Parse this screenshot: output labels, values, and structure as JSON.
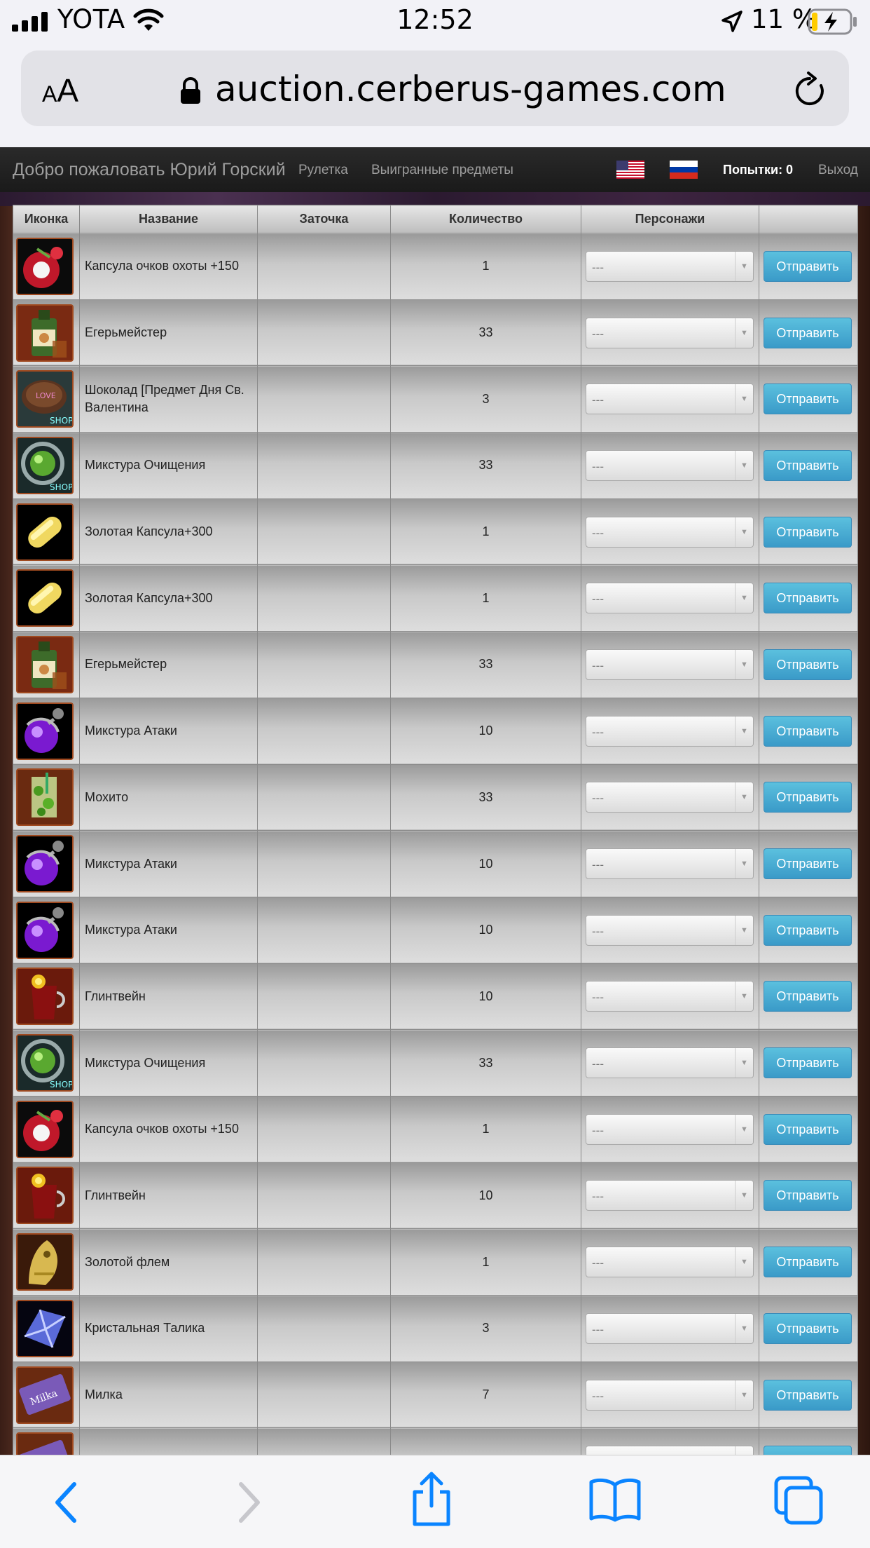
{
  "status_bar": {
    "carrier": "YOTA",
    "time": "12:52",
    "battery": "11 %"
  },
  "browser": {
    "text_size_label": "AA",
    "url": "auction.cerberus-games.com"
  },
  "nav": {
    "welcome": "Добро пожаловать Юрий Горский",
    "roulette": "Рулетка",
    "won_items": "Выигранные предметы",
    "attempts": "Попытки: 0",
    "logout": "Выход"
  },
  "table": {
    "headers": [
      "Иконка",
      "Название",
      "Заточка",
      "Количество",
      "Персонажи",
      ""
    ],
    "select_default": "---",
    "send_label": "Отправить",
    "rows": [
      {
        "name": "Капсула очков охоты +150",
        "enchant": "",
        "qty": "1",
        "icon": "hunt-capsule-icon"
      },
      {
        "name": "Егерьмейстер",
        "enchant": "",
        "qty": "33",
        "icon": "liquor-bottle-icon"
      },
      {
        "name": "Шоколад [Предмет Дня Св. Валентина",
        "enchant": "",
        "qty": "3",
        "icon": "chocolate-icon"
      },
      {
        "name": "Микстура Очищения",
        "enchant": "",
        "qty": "33",
        "icon": "cleansing-potion-icon"
      },
      {
        "name": "Золотая Капсула+300",
        "enchant": "",
        "qty": "1",
        "icon": "gold-capsule-icon"
      },
      {
        "name": "Золотая Капсула+300",
        "enchant": "",
        "qty": "1",
        "icon": "gold-capsule-icon"
      },
      {
        "name": "Егерьмейстер",
        "enchant": "",
        "qty": "33",
        "icon": "liquor-bottle-icon"
      },
      {
        "name": "Микстура Атаки",
        "enchant": "",
        "qty": "10",
        "icon": "attack-potion-icon"
      },
      {
        "name": "Мохито",
        "enchant": "",
        "qty": "33",
        "icon": "mojito-icon"
      },
      {
        "name": "Микстура Атаки",
        "enchant": "",
        "qty": "10",
        "icon": "attack-potion-icon"
      },
      {
        "name": "Микстура Атаки",
        "enchant": "",
        "qty": "10",
        "icon": "attack-potion-icon"
      },
      {
        "name": "Глинтвейн",
        "enchant": "",
        "qty": "10",
        "icon": "mulled-wine-icon"
      },
      {
        "name": "Микстура Очищения",
        "enchant": "",
        "qty": "33",
        "icon": "cleansing-potion-icon"
      },
      {
        "name": "Капсула очков охоты +150",
        "enchant": "",
        "qty": "1",
        "icon": "hunt-capsule-icon"
      },
      {
        "name": "Глинтвейн",
        "enchant": "",
        "qty": "10",
        "icon": "mulled-wine-icon"
      },
      {
        "name": "Золотой флем",
        "enchant": "",
        "qty": "1",
        "icon": "gold-figure-icon"
      },
      {
        "name": "Кристальная Талика",
        "enchant": "",
        "qty": "3",
        "icon": "crystal-icon"
      },
      {
        "name": "Милка",
        "enchant": "",
        "qty": "7",
        "icon": "milka-icon"
      },
      {
        "name": "",
        "enchant": "",
        "qty": "",
        "icon": "milka-icon"
      }
    ]
  },
  "colors": {
    "send_button": "#5bc0de",
    "nav_bg": "#222222",
    "ios_blue": "#0a84ff"
  }
}
